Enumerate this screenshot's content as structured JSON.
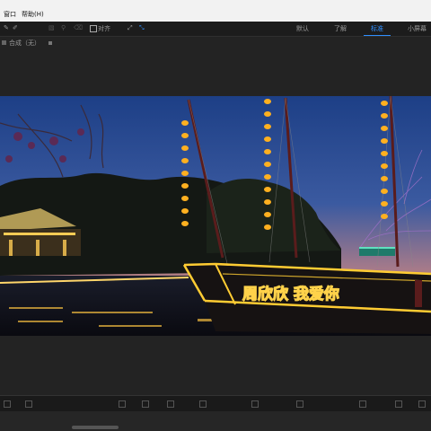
{
  "menu": {
    "items": [
      "窗口",
      "帮助(H)"
    ]
  },
  "toolbar": {
    "align_label": "对齐",
    "workspaces": [
      "默认",
      "了解",
      "标准",
      "小屏幕"
    ],
    "active_workspace": "标准"
  },
  "composition": {
    "tab_label": "合成（无）"
  },
  "viewer": {
    "boat_sign": "周欣欣 我爱你"
  },
  "colors": {
    "accent": "#2f8fff",
    "sky_top": "#1d3f86",
    "sky_horizon": "#e0884a",
    "lantern": "#ffb020",
    "neon": "#ffcc33"
  }
}
